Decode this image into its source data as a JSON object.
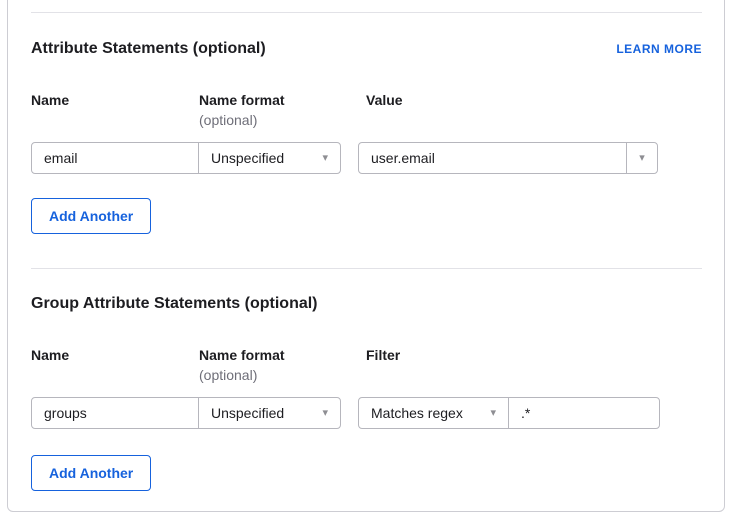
{
  "attribute_statements": {
    "title": "Attribute Statements (optional)",
    "learn_more": "LEARN MORE",
    "headers": {
      "name": "Name",
      "name_format": "Name format",
      "name_format_note": "(optional)",
      "value": "Value"
    },
    "row": {
      "name": "email",
      "name_format": "Unspecified",
      "value": "user.email"
    },
    "add_button": "Add Another"
  },
  "group_attribute_statements": {
    "title": "Group Attribute Statements (optional)",
    "headers": {
      "name": "Name",
      "name_format": "Name format",
      "name_format_note": "(optional)",
      "filter": "Filter"
    },
    "row": {
      "name": "groups",
      "name_format": "Unspecified",
      "filter_type": "Matches regex",
      "filter_value": ".*"
    },
    "add_button": "Add Another"
  },
  "icons": {
    "dropdown_caret": "▾"
  },
  "colors": {
    "accent_blue": "#1662dd",
    "text_dark": "#1d1d21",
    "text_muted": "#6e6e78",
    "input_border": "#b6b6bd",
    "panel_border": "#cdcdd3",
    "divider": "#e2e2e7"
  }
}
